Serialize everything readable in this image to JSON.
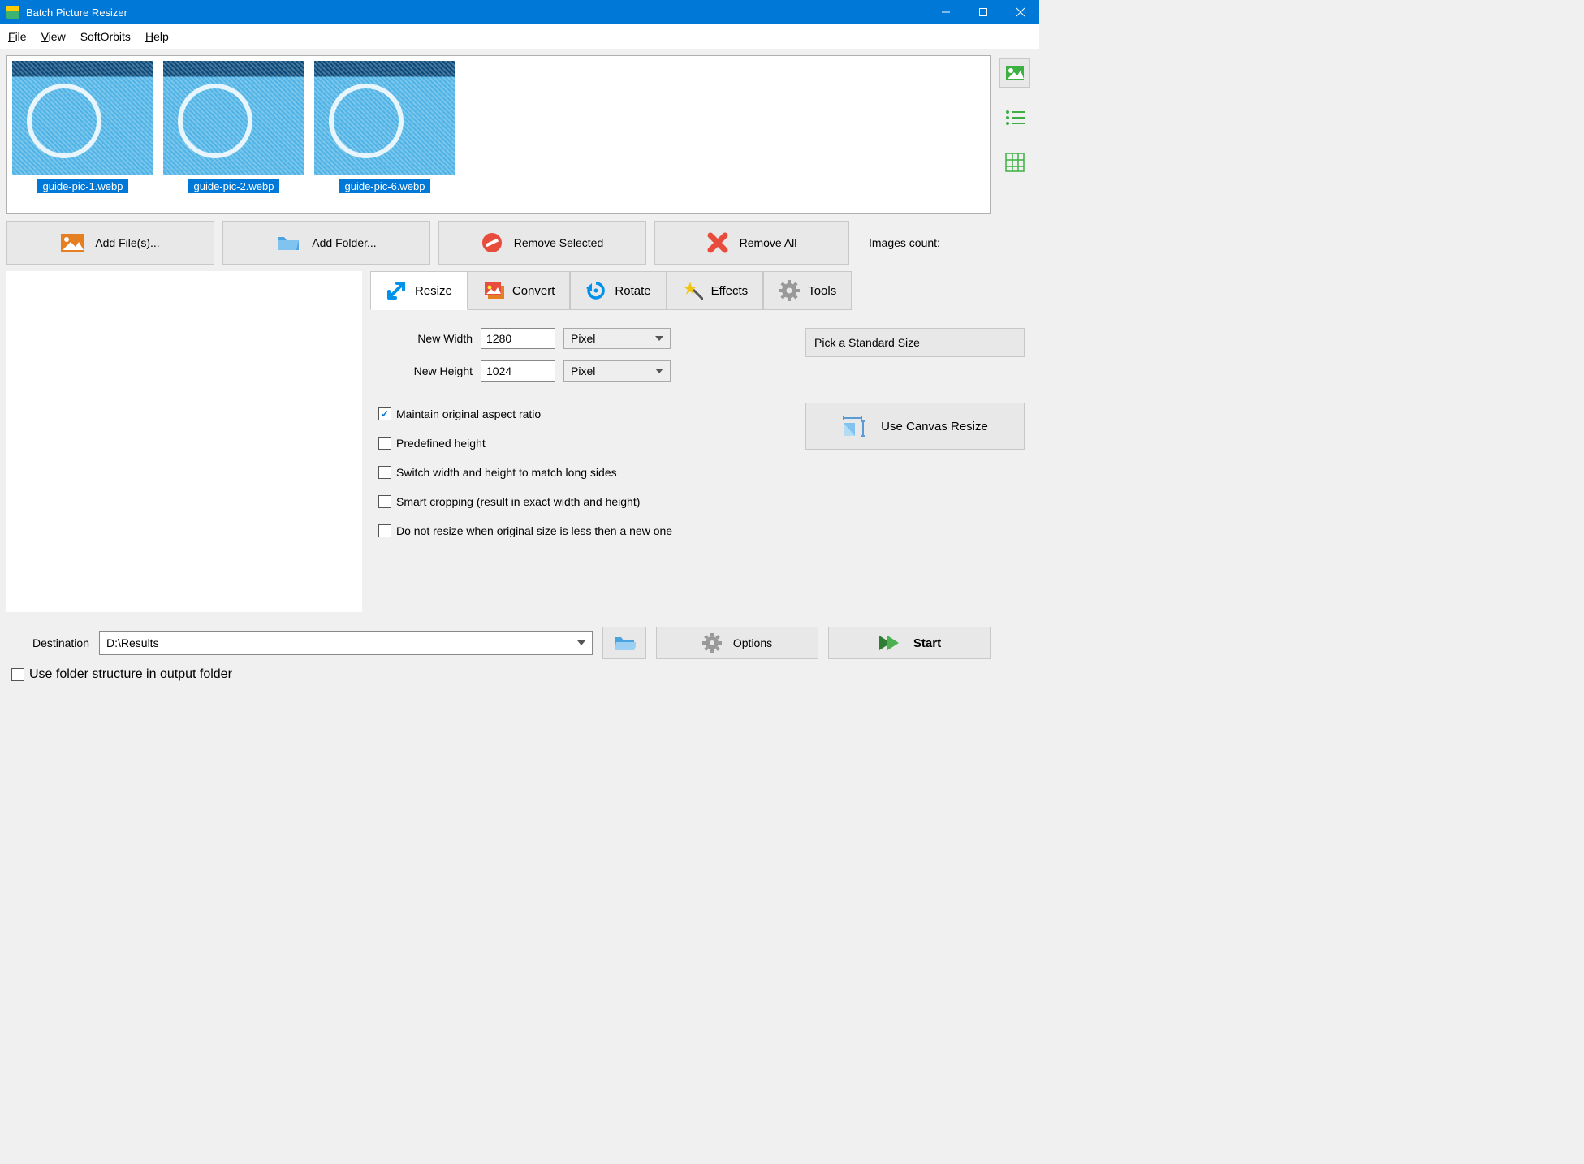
{
  "titlebar": {
    "title": "Batch Picture Resizer"
  },
  "menu": {
    "file": "File",
    "view": "View",
    "softorbits": "SoftOrbits",
    "help": "Help"
  },
  "thumbs": [
    {
      "label": "guide-pic-1.webp"
    },
    {
      "label": "guide-pic-2.webp"
    },
    {
      "label": "guide-pic-6.webp"
    }
  ],
  "toolbar": {
    "add_file": "Add File(s)...",
    "add_folder": "Add Folder...",
    "remove_selected_pre": "Remove ",
    "remove_selected_ul": "S",
    "remove_selected_post": "elected",
    "remove_all_pre": "Remove ",
    "remove_all_ul": "A",
    "remove_all_post": "ll",
    "images_count": "Images count:"
  },
  "tabs": {
    "resize": "Resize",
    "convert": "Convert",
    "rotate": "Rotate",
    "effects": "Effects",
    "tools": "Tools"
  },
  "resize": {
    "new_width_label": "New Width",
    "new_width_value": "1280",
    "new_height_label": "New Height",
    "new_height_value": "1024",
    "unit_width": "Pixel",
    "unit_height": "Pixel",
    "chk_aspect": "Maintain original aspect ratio",
    "chk_predef": "Predefined height",
    "chk_switch": "Switch width and height to match long sides",
    "chk_smart": "Smart cropping (result in exact width and height)",
    "chk_noenlarge": "Do not resize when original size is less then a new one",
    "pick_size": "Pick a Standard Size",
    "canvas_resize": "Use Canvas Resize"
  },
  "bottom": {
    "destination_label": "Destination",
    "destination_value": "D:\\Results",
    "options": "Options",
    "start": "Start",
    "use_folder_structure": "Use folder structure in output folder"
  }
}
